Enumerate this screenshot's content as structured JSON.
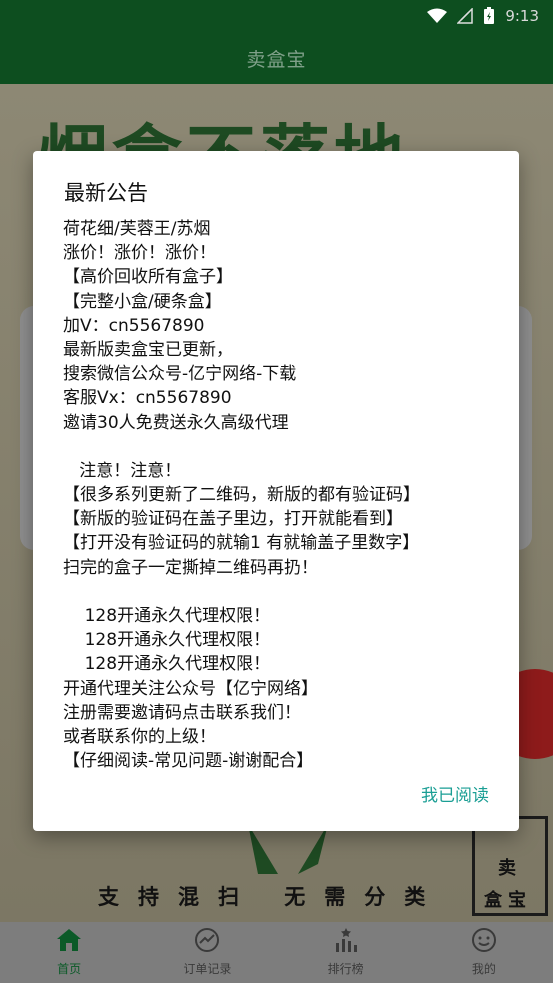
{
  "status_bar": {
    "time": "9:13"
  },
  "app_bar": {
    "title": "卖盒宝"
  },
  "background": {
    "heading": "烟盒不落地",
    "slogan": "支持混扫 无需分类",
    "stamp_a": "卖",
    "stamp_b": "盒宝"
  },
  "dialog": {
    "title": "最新公告",
    "lines": [
      "荷花细/芙蓉王/苏烟",
      "涨价！涨价！涨价！",
      "【高价回收所有盒子】",
      "【完整小盒/硬条盒】",
      "加V：cn5567890",
      "最新版卖盒宝已更新，",
      "搜索微信公众号-亿宁网络-下载",
      "客服Vx：cn5567890",
      "邀请30人免费送永久高级代理",
      "",
      "   注意！注意！",
      "【很多系列更新了二维码，新版的都有验证码】",
      "【新版的验证码在盖子里边，打开就能看到】",
      "【打开没有验证码的就输1 有就输盖子里数字】",
      "扫完的盒子一定撕掉二维码再扔！",
      "",
      "    128开通永久代理权限！",
      "    128开通永久代理权限！",
      "    128开通永久代理权限！",
      "开通代理关注公众号【亿宁网络】",
      "注册需要邀请码点击联系我们！",
      "或者联系你的上级！",
      "【仔细阅读-常见问题-谢谢配合】"
    ],
    "confirm_label": "我已阅读"
  },
  "bottom_nav": {
    "items": [
      {
        "label": "首页",
        "icon": "home-icon",
        "active": true
      },
      {
        "label": "订单记录",
        "icon": "trend-icon",
        "active": false
      },
      {
        "label": "排行榜",
        "icon": "ranking-icon",
        "active": false
      },
      {
        "label": "我的",
        "icon": "profile-icon",
        "active": false
      }
    ]
  },
  "colors": {
    "primary": "#0d4e1f",
    "accent": "#1a9e94"
  }
}
